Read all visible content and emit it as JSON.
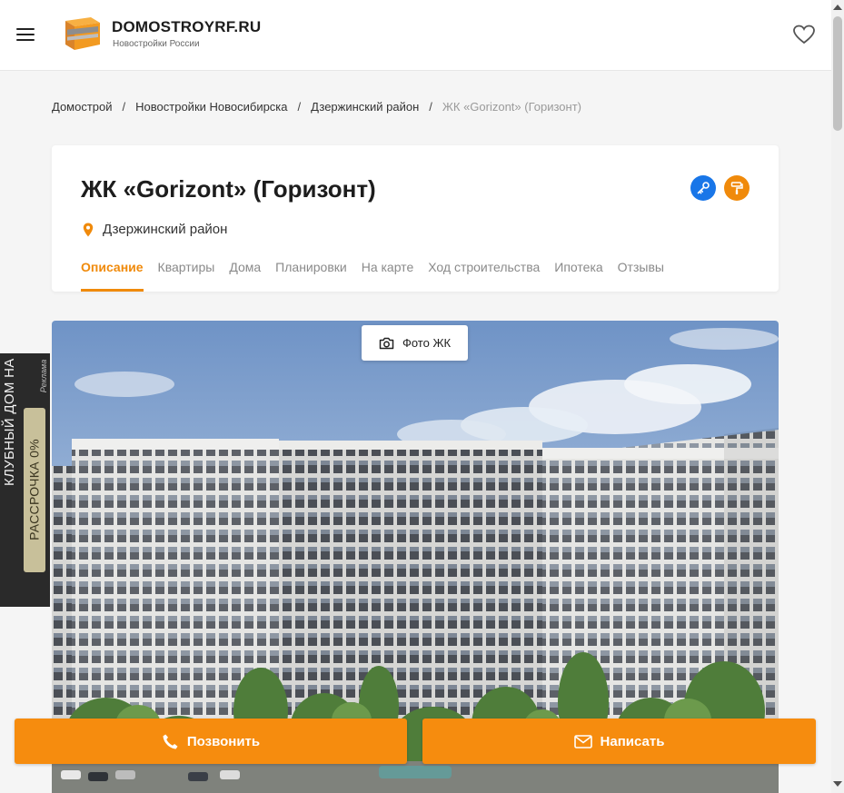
{
  "header": {
    "menu_icon": "hamburger-icon",
    "logo_title": "DOMOSTROYRF.RU",
    "logo_subtitle": "Новостройки России",
    "favorite_icon": "heart-icon"
  },
  "breadcrumb": [
    {
      "label": "Домострой"
    },
    {
      "label": "Новостройки Новосибирска"
    },
    {
      "label": "Дзержинский район"
    },
    {
      "label": "ЖК «Gorizont» (Горизонт)",
      "current": true
    }
  ],
  "breadcrumb_separator": "/",
  "complex": {
    "title": "ЖК «Gorizont» (Горизонт)",
    "location": "Дзержинский район",
    "badges": [
      {
        "icon": "key-icon",
        "color": "#1976e8"
      },
      {
        "icon": "paint-roller-icon",
        "color": "#f08a0b"
      }
    ]
  },
  "tabs": [
    {
      "label": "Описание",
      "active": true
    },
    {
      "label": "Квартиры"
    },
    {
      "label": "Дома"
    },
    {
      "label": "Планировки"
    },
    {
      "label": "На карте"
    },
    {
      "label": "Ход строительства"
    },
    {
      "label": "Ипотека"
    },
    {
      "label": "Отзывы"
    }
  ],
  "gallery": {
    "button_label": "Фото ЖК",
    "button_icon": "camera-icon"
  },
  "side_ad": {
    "text": "КЛУБНЫЙ ДОМ НА БЕРЕГУ ОКИ",
    "badge": "РАССРОЧКА 0%",
    "label": "Реклама"
  },
  "actions": {
    "call_label": "Позвонить",
    "call_icon": "phone-icon",
    "write_label": "Написать",
    "write_icon": "envelope-icon"
  },
  "colors": {
    "accent": "#f08a0b",
    "cta": "#f68c0e",
    "badge_blue": "#1976e8"
  }
}
